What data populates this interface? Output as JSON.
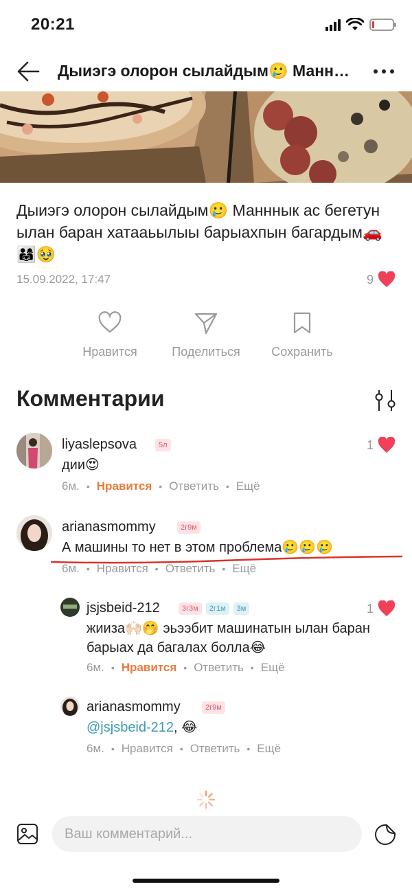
{
  "status_bar": {
    "time": "20:21"
  },
  "nav": {
    "title": "Дыиэгэ олорон сылайдым🥲 Манннык ас бегетун ылан баран хатааьылыы барыахпын багардым🚗👨‍👩‍👧🥹"
  },
  "post": {
    "text": "Дыиэгэ олорон сылайдым🥲 Манннык ас бегетун ылан баран хатааьылыы барыахпын багардым🚗👨‍👩‍👧🥹",
    "date": "15.09.2022, 17:47",
    "likes": "9"
  },
  "actions": {
    "like": "Нравится",
    "share": "Поделиться",
    "save": "Сохранить"
  },
  "comments": {
    "title": "Комментарии",
    "items": [
      {
        "name": "liyaslepsova",
        "badges": [
          "5л"
        ],
        "text": "дии😍",
        "time": "6м.",
        "like": "Нравится",
        "reply": "Ответить",
        "more": "Ещё",
        "likes": "1"
      },
      {
        "name": "arianasmommy",
        "badges": [
          "2г9м"
        ],
        "text": "А машины то нет в этом проблема🥲🥲🥲",
        "time": "6м.",
        "like": "Нравится",
        "reply": "Ответить",
        "more": "Ещё"
      },
      {
        "name": "jsjsbeid-212",
        "badges": [
          "3г3м",
          "2г1м",
          "3м"
        ],
        "text": "жииза🙌🏻🤭 эьээбит машинатын ылан баран барыах да багалах болла😂",
        "time": "6м.",
        "like": "Нравится",
        "reply": "Ответить",
        "more": "Ещё",
        "likes": "1"
      },
      {
        "name": "arianasmommy",
        "badges": [
          "2г9м"
        ],
        "mention": "@jsjsbeid-212",
        "text": ", 😂",
        "time": "6м.",
        "like": "Нравится",
        "reply": "Ответить",
        "more": "Ещё"
      }
    ]
  },
  "input": {
    "placeholder": "Ваш комментарий..."
  },
  "colors": {
    "accent_heart": "#f0405a",
    "liked_orange": "#e87a3b",
    "mention_blue": "#3b9ab8",
    "annotation_red": "#d9342b"
  }
}
